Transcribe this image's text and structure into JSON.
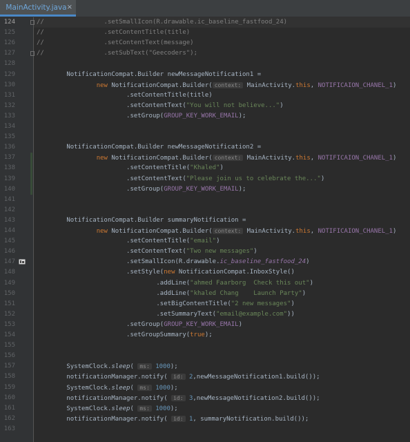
{
  "tab": {
    "label": "MainActivity.java",
    "close": "×"
  },
  "lines": [
    {
      "n": "124",
      "current": true,
      "segs": [
        [
          "cm",
          "//"
        ],
        [
          "cm",
          "                "
        ],
        [
          "cm",
          ".setSmallIcon(R.drawable.ic_baseline_fastfood_24)"
        ]
      ]
    },
    {
      "n": "125",
      "segs": [
        [
          "cm",
          "//"
        ],
        [
          "cm",
          "                "
        ],
        [
          "cm",
          ".setContentTitle(title)"
        ]
      ]
    },
    {
      "n": "126",
      "segs": [
        [
          "cm",
          "//"
        ],
        [
          "cm",
          "                "
        ],
        [
          "cm",
          ".setContentText(message)"
        ]
      ]
    },
    {
      "n": "127",
      "segs": [
        [
          "cm",
          "//"
        ],
        [
          "cm",
          "                "
        ],
        [
          "cm",
          ".setSubText(\"Geecoders\");"
        ]
      ]
    },
    {
      "n": "128",
      "segs": []
    },
    {
      "n": "129",
      "segs": [
        [
          "t",
          "        NotificationCompat.Builder newMessageNotification1 ="
        ]
      ]
    },
    {
      "n": "130",
      "segs": [
        [
          "t",
          "                "
        ],
        [
          "kw",
          "new "
        ],
        [
          "t",
          "NotificationCompat.Builder("
        ],
        [
          "hint",
          "context:"
        ],
        [
          "t",
          " MainActivity."
        ],
        [
          "kw",
          "this"
        ],
        [
          "t",
          ", "
        ],
        [
          "const",
          "NOTIFICAION_CHANEL_1"
        ],
        [
          "t",
          ")"
        ]
      ]
    },
    {
      "n": "131",
      "segs": [
        [
          "t",
          "                        .setContentTitle(title)"
        ]
      ]
    },
    {
      "n": "132",
      "segs": [
        [
          "t",
          "                        .setContentText("
        ],
        [
          "str",
          "\"You will not believe...\""
        ],
        [
          "t",
          ")"
        ]
      ]
    },
    {
      "n": "133",
      "segs": [
        [
          "t",
          "                        .setGroup("
        ],
        [
          "const",
          "GROUP_KEY_WORK_EMAIL"
        ],
        [
          "t",
          ");"
        ]
      ]
    },
    {
      "n": "134",
      "segs": []
    },
    {
      "n": "135",
      "segs": []
    },
    {
      "n": "136",
      "segs": [
        [
          "t",
          "        NotificationCompat.Builder newMessageNotification2 ="
        ]
      ]
    },
    {
      "n": "137",
      "segs": [
        [
          "t",
          "                "
        ],
        [
          "kw",
          "new "
        ],
        [
          "t",
          "NotificationCompat.Builder("
        ],
        [
          "hint",
          "context:"
        ],
        [
          "t",
          " MainActivity."
        ],
        [
          "kw",
          "this"
        ],
        [
          "t",
          ", "
        ],
        [
          "const",
          "NOTIFICAION_CHANEL_1"
        ],
        [
          "t",
          ")"
        ]
      ]
    },
    {
      "n": "138",
      "segs": [
        [
          "t",
          "                        .setContentTitle("
        ],
        [
          "str",
          "\"Khaled\""
        ],
        [
          "t",
          ")"
        ]
      ]
    },
    {
      "n": "139",
      "segs": [
        [
          "t",
          "                        .setContentText("
        ],
        [
          "str",
          "\"Please join us to celebrate the...\""
        ],
        [
          "t",
          ")"
        ]
      ]
    },
    {
      "n": "140",
      "segs": [
        [
          "t",
          "                        .setGroup("
        ],
        [
          "const",
          "GROUP_KEY_WORK_EMAIL"
        ],
        [
          "t",
          ");"
        ]
      ]
    },
    {
      "n": "141",
      "segs": []
    },
    {
      "n": "142",
      "segs": []
    },
    {
      "n": "143",
      "segs": [
        [
          "t",
          "        NotificationCompat.Builder summaryNotification ="
        ]
      ]
    },
    {
      "n": "144",
      "segs": [
        [
          "t",
          "                "
        ],
        [
          "kw",
          "new "
        ],
        [
          "t",
          "NotificationCompat.Builder("
        ],
        [
          "hint",
          "context:"
        ],
        [
          "t",
          " MainActivity."
        ],
        [
          "kw",
          "this"
        ],
        [
          "t",
          ", "
        ],
        [
          "const",
          "NOTIFICAION_CHANEL_1"
        ],
        [
          "t",
          ")"
        ]
      ]
    },
    {
      "n": "145",
      "segs": [
        [
          "t",
          "                        .setContentTitle("
        ],
        [
          "str",
          "\"email\""
        ],
        [
          "t",
          ")"
        ]
      ]
    },
    {
      "n": "146",
      "segs": [
        [
          "t",
          "                        .setContentText("
        ],
        [
          "str",
          "\"Two new messages\""
        ],
        [
          "t",
          ")"
        ]
      ]
    },
    {
      "n": "147",
      "segs": [
        [
          "t",
          "                        .setSmallIcon(R.drawable."
        ],
        [
          "consti",
          "ic_baseline_fastfood_24"
        ],
        [
          "t",
          ")"
        ]
      ]
    },
    {
      "n": "148",
      "segs": [
        [
          "t",
          "                        .setStyle("
        ],
        [
          "kw",
          "new "
        ],
        [
          "t",
          "NotificationCompat.InboxStyle()"
        ]
      ]
    },
    {
      "n": "149",
      "segs": [
        [
          "t",
          "                                .addLine("
        ],
        [
          "str",
          "\"ahmed Faarborg  Check this out\""
        ],
        [
          "t",
          ")"
        ]
      ]
    },
    {
      "n": "150",
      "segs": [
        [
          "t",
          "                                .addLine("
        ],
        [
          "str",
          "\"khaled Chang    Launch Party\""
        ],
        [
          "t",
          ")"
        ]
      ]
    },
    {
      "n": "151",
      "segs": [
        [
          "t",
          "                                .setBigContentTitle("
        ],
        [
          "str",
          "\"2 new messages\""
        ],
        [
          "t",
          ")"
        ]
      ]
    },
    {
      "n": "152",
      "segs": [
        [
          "t",
          "                                .setSummaryText("
        ],
        [
          "str",
          "\"email@example.com\""
        ],
        [
          "t",
          "))"
        ]
      ]
    },
    {
      "n": "153",
      "segs": [
        [
          "t",
          "                        .setGroup("
        ],
        [
          "const",
          "GROUP_KEY_WORK_EMAIL"
        ],
        [
          "t",
          ")"
        ]
      ]
    },
    {
      "n": "154",
      "segs": [
        [
          "t",
          "                        .setGroupSummary("
        ],
        [
          "kw",
          "true"
        ],
        [
          "t",
          ");"
        ]
      ]
    },
    {
      "n": "155",
      "segs": []
    },
    {
      "n": "156",
      "segs": []
    },
    {
      "n": "157",
      "segs": [
        [
          "t",
          "        SystemClock."
        ],
        [
          "it",
          "sleep"
        ],
        [
          "t",
          "( "
        ],
        [
          "hint",
          "ms:"
        ],
        [
          "t",
          " "
        ],
        [
          "num",
          "1000"
        ],
        [
          "t",
          ");"
        ]
      ]
    },
    {
      "n": "158",
      "segs": [
        [
          "t",
          "        notificationManager.notify( "
        ],
        [
          "hint",
          "id:"
        ],
        [
          "t",
          " "
        ],
        [
          "num",
          "2"
        ],
        [
          "t",
          ",newMessageNotification1.build());"
        ]
      ]
    },
    {
      "n": "159",
      "segs": [
        [
          "t",
          "        SystemClock."
        ],
        [
          "it",
          "sleep"
        ],
        [
          "t",
          "( "
        ],
        [
          "hint",
          "ms:"
        ],
        [
          "t",
          " "
        ],
        [
          "num",
          "1000"
        ],
        [
          "t",
          ");"
        ]
      ]
    },
    {
      "n": "160",
      "segs": [
        [
          "t",
          "        notificationManager.notify( "
        ],
        [
          "hint",
          "id:"
        ],
        [
          "t",
          " "
        ],
        [
          "num",
          "3"
        ],
        [
          "t",
          ",newMessageNotification2.build());"
        ]
      ]
    },
    {
      "n": "161",
      "segs": [
        [
          "t",
          "        SystemClock."
        ],
        [
          "it",
          "sleep"
        ],
        [
          "t",
          "( "
        ],
        [
          "hint",
          "ms:"
        ],
        [
          "t",
          " "
        ],
        [
          "num",
          "1000"
        ],
        [
          "t",
          ");"
        ]
      ]
    },
    {
      "n": "162",
      "segs": [
        [
          "t",
          "        notificationManager.notify( "
        ],
        [
          "hint",
          "id:"
        ],
        [
          "t",
          " "
        ],
        [
          "num",
          "1"
        ],
        [
          "t",
          ", summaryNotification.build());"
        ]
      ]
    },
    {
      "n": "163",
      "segs": []
    }
  ]
}
